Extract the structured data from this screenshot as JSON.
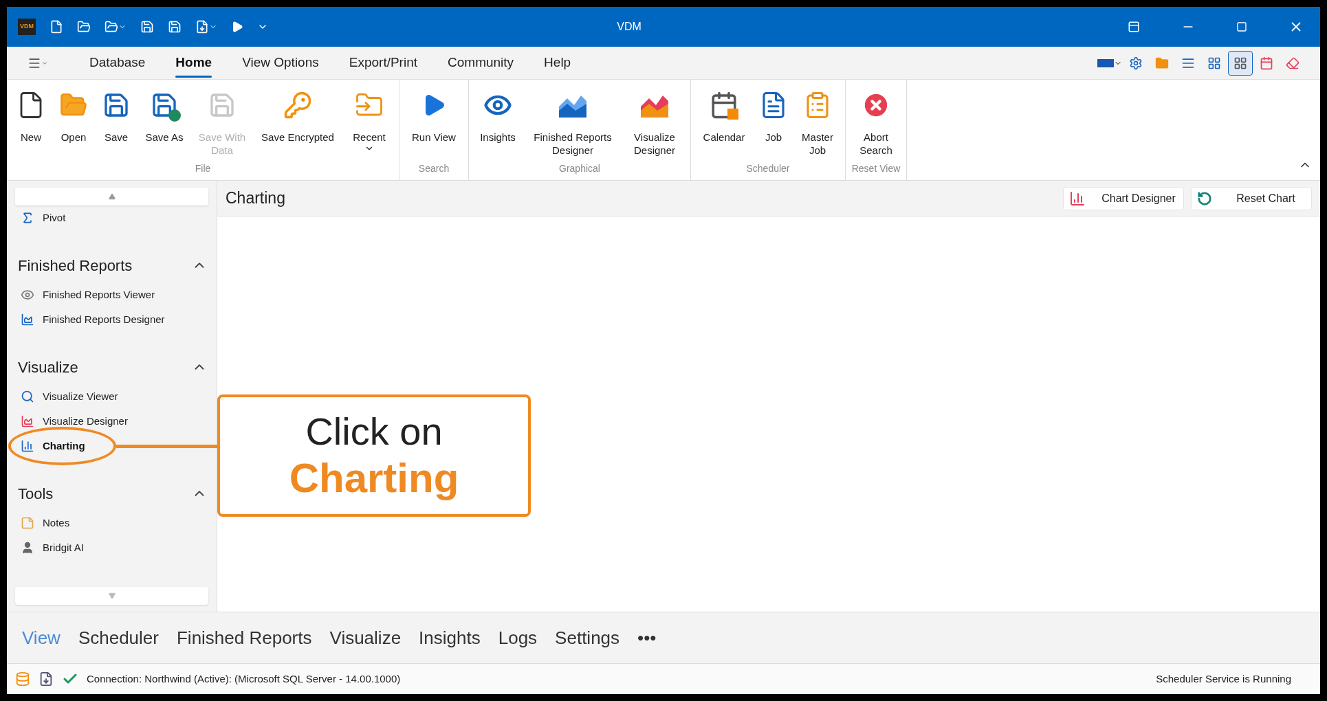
{
  "window": {
    "logo_text": "VDM",
    "title": "VDM"
  },
  "menu_tabs": [
    {
      "label": "Database",
      "selected": false
    },
    {
      "label": "Home",
      "selected": true
    },
    {
      "label": "View Options",
      "selected": false
    },
    {
      "label": "Export/Print",
      "selected": false
    },
    {
      "label": "Community",
      "selected": false
    },
    {
      "label": "Help",
      "selected": false
    }
  ],
  "right_tools": [
    {
      "selected": false
    },
    {
      "selected": false
    },
    {
      "selected": false
    },
    {
      "selected": false
    },
    {
      "selected": false
    },
    {
      "selected": true
    },
    {
      "selected": false
    },
    {
      "selected": false
    }
  ],
  "ribbon": [
    {
      "label": "File",
      "items": [
        {
          "label": "New",
          "disabled": false
        },
        {
          "label": "Open",
          "disabled": false
        },
        {
          "label": "Save",
          "disabled": false
        },
        {
          "label": "Save As",
          "disabled": false
        },
        {
          "label": "Save With Data",
          "disabled": true
        },
        {
          "label": "Save Encrypted",
          "disabled": false
        },
        {
          "label": "Recent",
          "disabled": false,
          "dropdown": true
        }
      ]
    },
    {
      "label": "Search",
      "items": [
        {
          "label": "Run View",
          "disabled": false
        }
      ]
    },
    {
      "label": "Graphical",
      "items": [
        {
          "label": "Insights",
          "disabled": false
        },
        {
          "label": "Finished Reports Designer",
          "disabled": false
        },
        {
          "label": "Visualize Designer",
          "disabled": false
        }
      ]
    },
    {
      "label": "Scheduler",
      "items": [
        {
          "label": "Calendar",
          "disabled": false
        },
        {
          "label": "Job",
          "disabled": false
        },
        {
          "label": "Master Job",
          "disabled": false
        }
      ]
    },
    {
      "label": "Reset View",
      "items": [
        {
          "label": "Abort Search",
          "disabled": false
        }
      ]
    }
  ],
  "sidebar": {
    "top_items": [
      {
        "label": "Pivot",
        "selected": false
      }
    ],
    "sections": [
      {
        "title": "Finished Reports",
        "expanded": true,
        "items": [
          {
            "label": "Finished Reports Viewer",
            "selected": false
          },
          {
            "label": "Finished Reports Designer",
            "selected": false
          }
        ]
      },
      {
        "title": "Visualize",
        "expanded": true,
        "items": [
          {
            "label": "Visualize Viewer",
            "selected": false
          },
          {
            "label": "Visualize Designer",
            "selected": false
          },
          {
            "label": "Charting",
            "selected": true
          }
        ]
      },
      {
        "title": "Tools",
        "expanded": true,
        "items": [
          {
            "label": "Notes",
            "selected": false
          },
          {
            "label": "Bridgit AI",
            "selected": false
          }
        ]
      }
    ]
  },
  "content": {
    "title": "Charting",
    "buttons": [
      "Chart Designer",
      "Reset Chart"
    ]
  },
  "callout": {
    "line_1": "Click on",
    "line_2": "Charting"
  },
  "bottom_nav": [
    {
      "label": "View",
      "selected": true
    },
    {
      "label": "Scheduler",
      "selected": false
    },
    {
      "label": "Finished Reports",
      "selected": false
    },
    {
      "label": "Visualize",
      "selected": false
    },
    {
      "label": "Insights",
      "selected": false
    },
    {
      "label": "Logs",
      "selected": false
    },
    {
      "label": "Settings",
      "selected": false
    },
    {
      "label": "•••",
      "selected": false
    }
  ],
  "status_bar": {
    "connection": "Connection: Northwind (Active): (Microsoft SQL Server - 14.00.1000)",
    "service": "Scheduler Service is Running"
  }
}
